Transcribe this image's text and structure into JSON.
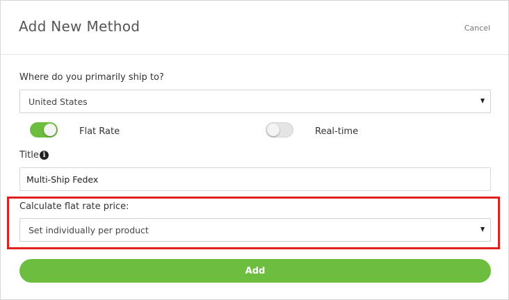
{
  "modal": {
    "title": "Add New Method",
    "cancel_label": "Cancel"
  },
  "ship_to": {
    "label": "Where do you primarily ship to?",
    "selected": "United States"
  },
  "rate_type": {
    "flat_rate": {
      "label": "Flat Rate",
      "enabled": true
    },
    "real_time": {
      "label": "Real-time",
      "enabled": false
    }
  },
  "title_field": {
    "label": "Title",
    "value": "Multi-Ship Fedex",
    "icon": "info-icon"
  },
  "flat_rate_price": {
    "label": "Calculate flat rate price:",
    "selected": "Set individually per product"
  },
  "actions": {
    "add_label": "Add"
  },
  "colors": {
    "accent_green": "#6dbd3e",
    "highlight_red": "#e01f1f"
  }
}
